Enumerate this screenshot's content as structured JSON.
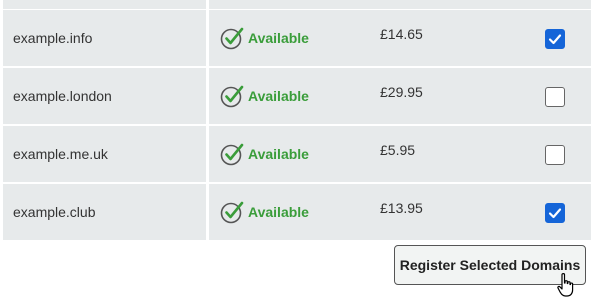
{
  "rows": [
    {
      "domain": "example.info",
      "status": "Available",
      "price": "£14.65",
      "selected": true
    },
    {
      "domain": "example.london",
      "status": "Available",
      "price": "£29.95",
      "selected": false
    },
    {
      "domain": "example.me.uk",
      "status": "Available",
      "price": "£5.95",
      "selected": false
    },
    {
      "domain": "example.club",
      "status": "Available",
      "price": "£13.95",
      "selected": true
    }
  ],
  "register_button": {
    "label": "Register Selected Domains"
  },
  "colors": {
    "row_background": "#e7eaeb",
    "available_green": "#3a9d3a",
    "checkbox_checked": "#1565d8"
  },
  "icons": {
    "status": "check-circle-icon",
    "checkbox_check": "checkmark-icon",
    "cursor": "hand-pointer-icon"
  }
}
